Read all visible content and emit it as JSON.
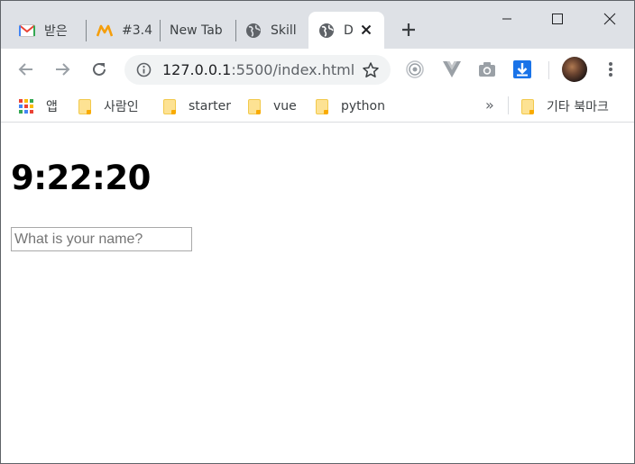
{
  "tabs": [
    {
      "label": "받은",
      "icon": "gmail-icon"
    },
    {
      "label": "#3.4",
      "icon": "orange-m-icon"
    },
    {
      "label": "New Tab",
      "icon": ""
    },
    {
      "label": "Skill",
      "icon": "globe-icon"
    },
    {
      "label": "D",
      "icon": "globe-icon",
      "active": true
    }
  ],
  "address": {
    "host": "127.0.0.1",
    "path": ":5500/index.html"
  },
  "bookmarks": {
    "apps_label": "앱",
    "items": [
      "사람인",
      "starter",
      "vue",
      "python"
    ],
    "more": "»",
    "other_label": "기타 북마크"
  },
  "page": {
    "clock": "9:22:20",
    "name_placeholder": "What is your name?"
  },
  "colors": {
    "tabstrip": "#dee1e6",
    "omnibox": "#f1f3f4",
    "folder": "#fde293"
  }
}
